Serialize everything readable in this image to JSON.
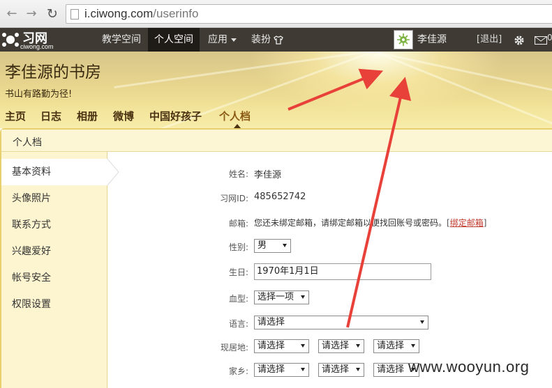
{
  "browser": {
    "url_host": "i.ciwong.com",
    "url_path": "/userinfo"
  },
  "site_nav": {
    "logo_name": "习网",
    "logo_domain": "ciwong.com",
    "items": [
      {
        "label": "教学空间"
      },
      {
        "label": "个人空间"
      },
      {
        "label": "应用"
      },
      {
        "label": "装扮"
      }
    ],
    "user_name": "李佳源",
    "logout": "[退出]",
    "mail_count": "0"
  },
  "banner": {
    "title": "李佳源的书房",
    "motto": "书山有路勤为径!",
    "tabs": [
      {
        "label": "主页"
      },
      {
        "label": "日志"
      },
      {
        "label": "相册"
      },
      {
        "label": "微博"
      },
      {
        "label": "中国好孩子"
      },
      {
        "label": "个人档"
      }
    ]
  },
  "section_title": "个人档",
  "left_menu": [
    {
      "label": "基本资料"
    },
    {
      "label": "头像照片"
    },
    {
      "label": "联系方式"
    },
    {
      "label": "兴趣爱好"
    },
    {
      "label": "帐号安全"
    },
    {
      "label": "权限设置"
    }
  ],
  "form": {
    "name_label": "姓名:",
    "name_value": "李佳源",
    "id_label": "习网ID:",
    "id_value": "485652742",
    "email_label": "邮箱:",
    "email_text": "您还未绑定邮箱，请绑定邮箱以便找回账号或密码。",
    "email_bracket_open": "[",
    "email_link": "绑定邮箱",
    "email_bracket_close": "]",
    "gender_label": "性别:",
    "gender_value": "男",
    "birthday_label": "生日:",
    "birthday_value": "1970年1月1日",
    "blood_label": "血型:",
    "blood_value": "选择一项",
    "language_label": "语言:",
    "language_value": "请选择",
    "residence_label": "现居地:",
    "residence_values": [
      "请选择",
      "请选择",
      "请选择"
    ],
    "hometown_label": "家乡:",
    "hometown_values": [
      "请选择",
      "请选择",
      "请选择"
    ]
  },
  "watermark": "www.wooyun.org",
  "colors": {
    "site_nav_bg": "#3f3a33",
    "accent_link": "#c0392b",
    "annotation_arrow": "#e8413a"
  }
}
